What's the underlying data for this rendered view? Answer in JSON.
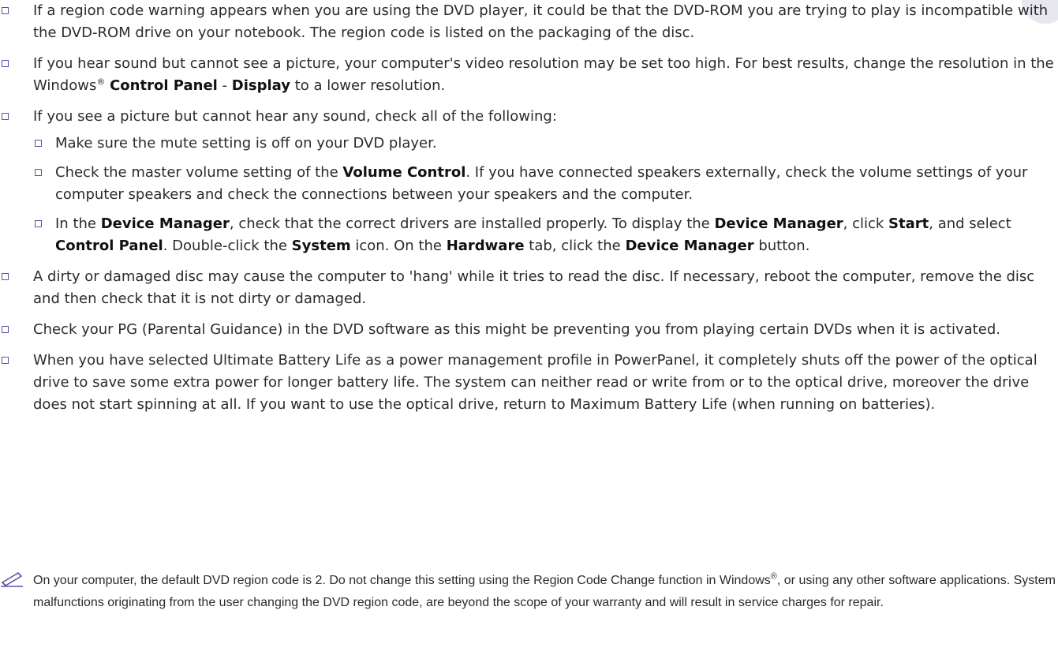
{
  "items": [
    {
      "text": "If a region code warning appears when you are using the DVD player, it could be that the DVD-ROM you are trying to play is incompatible with the DVD-ROM drive on your notebook. The region code is listed on the packaging of the disc."
    },
    {
      "t1": "If you hear sound but cannot see a picture, your computer's video resolution may be set too high. For best results, change the resolution in the Windows",
      "reg": "®",
      "b1": "Control Panel",
      "sep": " - ",
      "b2": "Display",
      "t2": " to a lower resolution."
    },
    {
      "text": "If you see a picture but cannot hear any sound, check all of the following:",
      "subitems": [
        {
          "text": "Make sure the mute setting is off on your DVD player."
        },
        {
          "t1": "Check the master volume setting of the ",
          "b1": "Volume Control",
          "t2": ". If you have connected speakers externally, check the volume settings of your computer speakers and check the connections between your speakers and the computer."
        },
        {
          "t1": "In the ",
          "b1": "Device Manager",
          "t2": ", check that the correct drivers are installed properly. To display the ",
          "b2": "Device Manager",
          "t3": ", click ",
          "b3": "Start",
          "t4": ", and select ",
          "b4": "Control Panel",
          "t5": ". Double-click the ",
          "b5": "System",
          "t6": " icon. On the ",
          "b6": "Hardware",
          "t7": " tab, click the ",
          "b7": "Device Manager",
          "t8": " button."
        }
      ]
    },
    {
      "text": "A dirty or damaged disc may cause the computer to 'hang' while it tries to read the disc. If necessary, reboot the computer, remove the disc and then check that it is not dirty or damaged."
    },
    {
      "text": "Check your PG (Parental Guidance) in the DVD software as this might be preventing you from playing certain DVDs when it is activated."
    },
    {
      "text": "When you have selected Ultimate Battery Life as a power management profile in PowerPanel, it completely shuts off the power of the optical drive to save some extra power for longer battery life. The system can neither read or write from or to the optical drive, moreover the drive does not start spinning at all. If you want to use the optical drive, return to Maximum Battery Life (when running on batteries)."
    }
  ],
  "note": {
    "t1": "On your computer, the default DVD region code is 2. Do not change this setting using the Region Code Change function in Windows",
    "reg": "®",
    "t2": ", or using any other software applications. System malfunctions originating from the user changing the DVD region code, are beyond the scope of your warranty and will result in service charges for repair."
  },
  "icons": {
    "bullet": "checkbox-bullet-icon",
    "note": "pencil-note-icon"
  },
  "colors": {
    "bullet": "#5b53a3",
    "text": "#2b2b2b"
  }
}
